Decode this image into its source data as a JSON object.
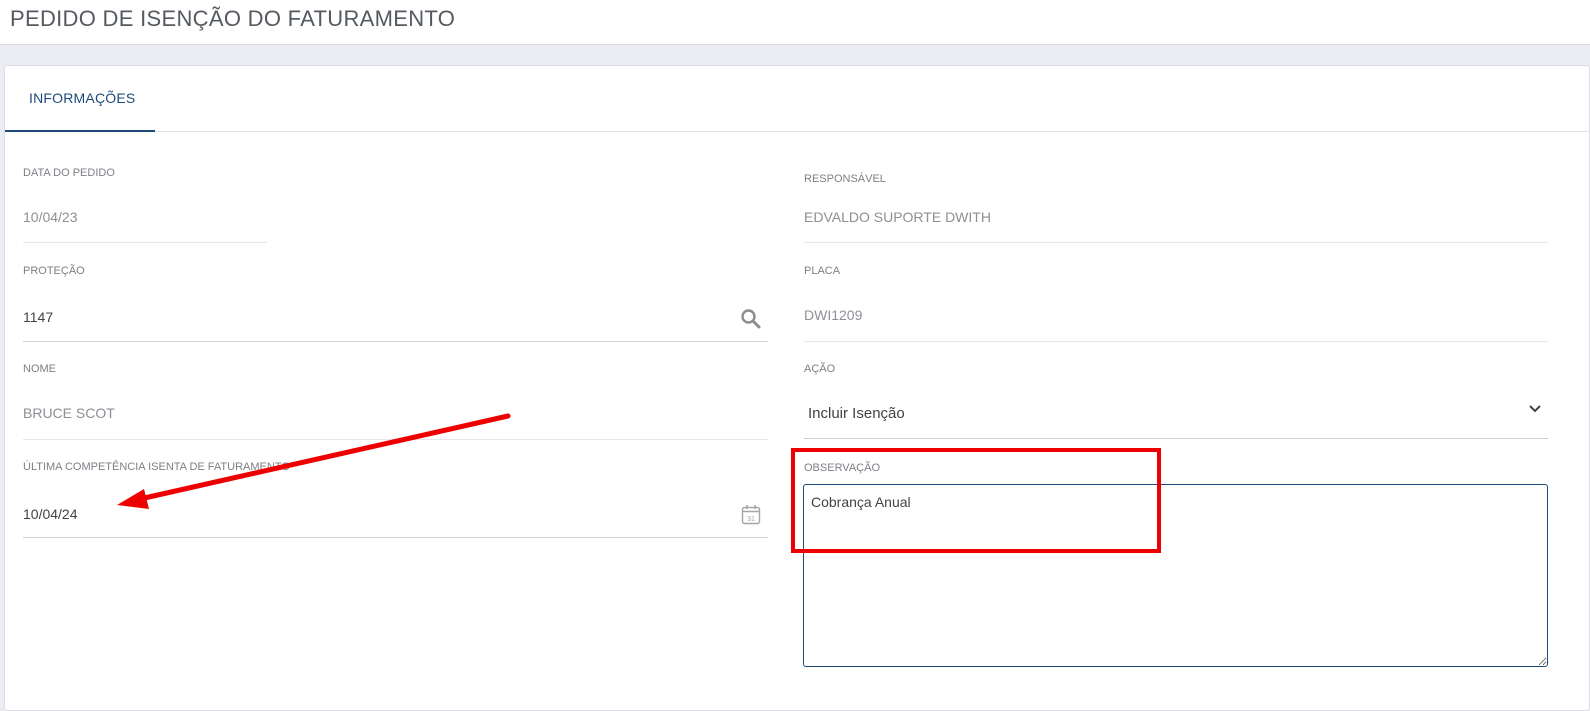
{
  "header": {
    "title": "PEDIDO DE ISENÇÃO DO FATURAMENTO"
  },
  "tabs": [
    {
      "label": "INFORMAÇÕES",
      "active": true
    }
  ],
  "form": {
    "data_pedido": {
      "label": "DATA DO PEDIDO",
      "value": "10/04/23"
    },
    "responsavel": {
      "label": "RESPONSÁVEL",
      "value": "EDVALDO SUPORTE DWITH"
    },
    "protecao": {
      "label": "PROTEÇÃO",
      "value": "1147"
    },
    "placa": {
      "label": "PLACA",
      "value": "DWI1209"
    },
    "nome": {
      "label": "NOME",
      "value": "BRUCE SCOT"
    },
    "acao": {
      "label": "AÇÃO",
      "value": "Incluir Isenção"
    },
    "ultima_competencia": {
      "label": "ÚLTIMA COMPETÊNCIA ISENTA DE FATURAMENTO",
      "value": "10/04/24"
    },
    "observacao": {
      "label": "OBSERVAÇÃO",
      "value": "Cobrança Anual"
    }
  },
  "icons": {
    "protecao_search": "search-icon",
    "competencia_calendar": "calendar-icon",
    "acao_dropdown": "chevron-down-icon"
  },
  "calendar_icon_day": "31",
  "colors": {
    "accent": "#1e4a7a",
    "annotation": "#ef0000"
  }
}
